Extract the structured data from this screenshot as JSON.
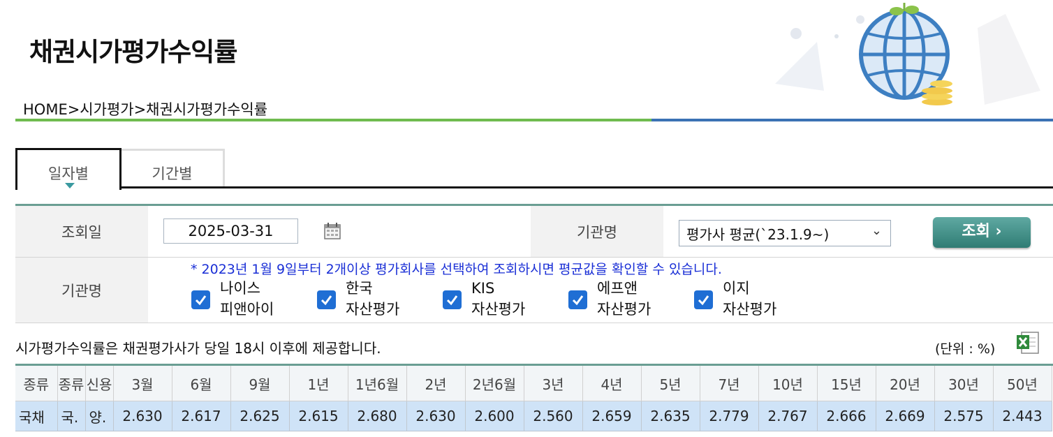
{
  "page": {
    "title": "채권시가평가수익률",
    "breadcrumb": "HOME>시가평가>채권시가평가수익률"
  },
  "tabs": [
    {
      "label": "일자별",
      "active": true
    },
    {
      "label": "기간별",
      "active": false
    }
  ],
  "form": {
    "date_label": "조회일",
    "date_value": "2025-03-31",
    "org_label": "기관명",
    "org_selected": "평가사 평균(`23.1.9~)",
    "search_button": "조회",
    "org_label2": "기관명",
    "notice": "* 2023년 1월 9일부터 2개이상 평가회사를 선택하여 조회하시면 평균값을 확인할 수 있습니다.",
    "checkboxes": [
      {
        "line1": "나이스",
        "line2": "피앤아이",
        "checked": true
      },
      {
        "line1": "한국",
        "line2": "자산평가",
        "checked": true
      },
      {
        "line1": "KIS",
        "line2": "자산평가",
        "checked": true
      },
      {
        "line1": "에프앤",
        "line2": "자산평가",
        "checked": true
      },
      {
        "line1": "이지",
        "line2": "자산평가",
        "checked": true
      }
    ]
  },
  "caption": "시가평가수익률은 채권평가사가 당일 18시 이후에 제공합니다.",
  "unit": "(단위 : %)",
  "table": {
    "headers": [
      "종류",
      "종류",
      "신용",
      "3월",
      "6월",
      "9월",
      "1년",
      "1년6월",
      "2년",
      "2년6월",
      "3년",
      "4년",
      "5년",
      "7년",
      "10년",
      "15년",
      "20년",
      "30년",
      "50년"
    ],
    "rows": [
      [
        "국채",
        "국.",
        "양.",
        "2.630",
        "2.617",
        "2.625",
        "2.615",
        "2.680",
        "2.630",
        "2.600",
        "2.560",
        "2.659",
        "2.635",
        "2.779",
        "2.767",
        "2.666",
        "2.669",
        "2.575",
        "2.443"
      ]
    ]
  },
  "colors": {
    "rule_green": "#6fbb4f",
    "rule_blue": "#3b72b4",
    "notice_text": "#1a2fd6",
    "row_highlight": "#cfe3f7",
    "search_button": "#2f7c74"
  }
}
